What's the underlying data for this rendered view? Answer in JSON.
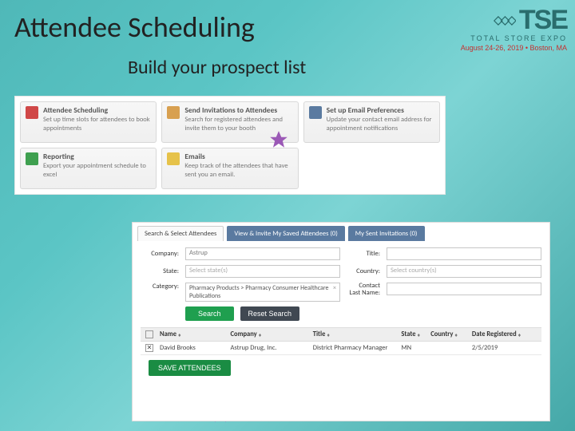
{
  "logo": {
    "text": "TSE",
    "subtitle": "TOTAL STORE EXPO",
    "date": "August 24-26, 2019 • Boston, MA"
  },
  "title": "Attendee Scheduling",
  "subtitle": "Build your prospect list",
  "tiles": [
    {
      "name": "attendee-scheduling",
      "title": "Attendee Scheduling",
      "desc": "Set up time slots for attendees to book appointments",
      "iconColor": "#d04848"
    },
    {
      "name": "send-invitations",
      "title": "Send Invitations to Attendees",
      "desc": "Search for registered attendees and invite them to your booth",
      "iconColor": "#d8a050"
    },
    {
      "name": "email-preferences",
      "title": "Set up Email Preferences",
      "desc": "Update your contact email address for appointment notifications",
      "iconColor": "#5a7aa0"
    },
    {
      "name": "reporting",
      "title": "Reporting",
      "desc": "Export your appointment schedule to excel",
      "iconColor": "#3fa050"
    },
    {
      "name": "emails",
      "title": "Emails",
      "desc": "Keep track of the attendees that have sent you an email.",
      "iconColor": "#e6c24a"
    }
  ],
  "form": {
    "tabs": [
      {
        "label": "Search & Select Attendees",
        "style": "plain"
      },
      {
        "label": "View & Invite My Saved Attendees (0)",
        "style": "blue"
      },
      {
        "label": "My Sent Invitations (0)",
        "style": "blue"
      }
    ],
    "labels": {
      "company": "Company:",
      "title": "Title:",
      "state": "State:",
      "country": "Country:",
      "category": "Category:",
      "contact_lastname": "Contact Last Name:"
    },
    "values": {
      "company": "Astrup",
      "title": "",
      "state_placeholder": "Select state(s)",
      "country_placeholder": "Select country(s)",
      "category": "Pharmacy Products > Pharmacy Consumer Healthcare Publications",
      "contact_lastname": ""
    },
    "buttons": {
      "search": "Search",
      "reset": "Reset Search",
      "save": "SAVE ATTENDEES"
    }
  },
  "table": {
    "headers": {
      "name": "Name",
      "company": "Company",
      "title": "Title",
      "state": "State",
      "country": "Country",
      "date": "Date Registered"
    },
    "rows": [
      {
        "checked": true,
        "name": "David Brooks",
        "company": "Astrup Drug, Inc.",
        "title": "District Pharmacy Manager",
        "state": "MN",
        "country": "",
        "date": "2/5/2019"
      }
    ]
  }
}
